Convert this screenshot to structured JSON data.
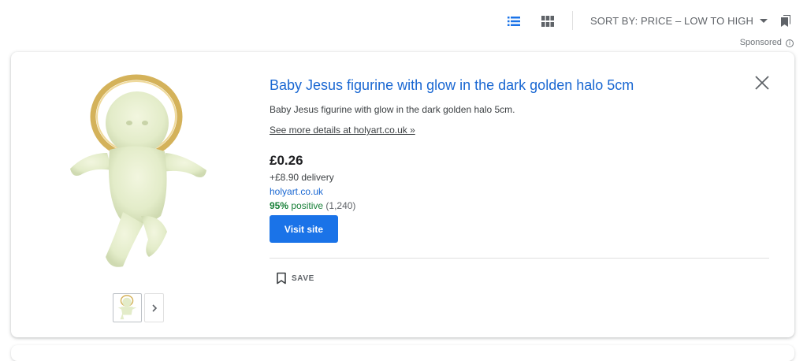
{
  "toolbar": {
    "list_view_icon": "list-view-icon",
    "grid_view_icon": "grid-view-icon",
    "sort_label": "SORT BY: PRICE – LOW TO HIGH",
    "bookmarks_icon": "bookmarks-icon",
    "accent_color": "#1a73e8"
  },
  "sponsored": {
    "label": "Sponsored",
    "info_icon": "i"
  },
  "product": {
    "title": "Baby Jesus figurine with glow in the dark golden halo 5cm",
    "description": "Baby Jesus figurine with glow in the dark golden halo 5cm.",
    "details_link": "See more details at holyart.co.uk »",
    "price": "£0.26",
    "delivery": "+£8.90 delivery",
    "store": "holyart.co.uk",
    "rating_percent": "95%",
    "rating_label": "positive",
    "rating_count": "(1,240)",
    "visit_button": "Visit site",
    "save_label": "SAVE",
    "rating_color": "#188038",
    "button_color": "#1a73e8"
  }
}
